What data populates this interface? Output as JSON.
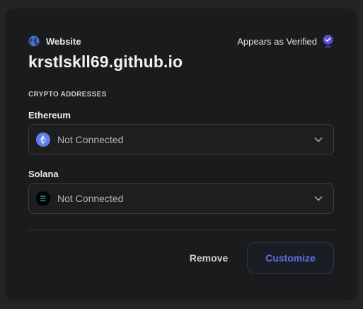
{
  "header": {
    "type_label": "Website",
    "type_icon": "globe-icon",
    "verified_label": "Appears as Verified",
    "verified_icon": "verified-badge-icon"
  },
  "domain": "krstlskll69.github.io",
  "crypto": {
    "section_title": "CRYPTO ADDRESSES",
    "fields": [
      {
        "label": "Ethereum",
        "value": "Not Connected",
        "icon": "ethereum-icon"
      },
      {
        "label": "Solana",
        "value": "Not Connected",
        "icon": "solana-icon"
      }
    ]
  },
  "actions": {
    "remove_label": "Remove",
    "customize_label": "Customize"
  },
  "colors": {
    "accent": "#5b73e4",
    "badge": "#5a4bd8",
    "background": "#191b1d"
  }
}
